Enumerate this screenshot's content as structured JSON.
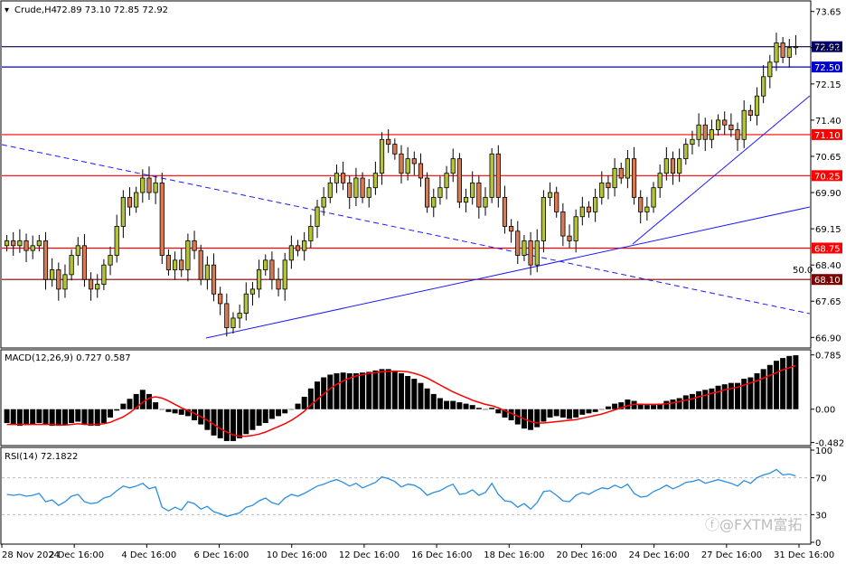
{
  "header": {
    "symbol": "Crude,H4",
    "ohlc": "72.89 73.10 72.85 72.92"
  },
  "watermark": "ⓕ@FXTM富拓",
  "colors": {
    "up_candle": "#b5c437",
    "down_candle": "#d97a52",
    "level": "#ff0000",
    "trend": "#1a1aff",
    "macd_signal": "#ff0000",
    "rsi": "#2b8de0"
  },
  "chart_data": [
    {
      "type": "candlestick",
      "title": "Crude,H4",
      "ylim": [
        66.7,
        73.85
      ],
      "y_ticks": [
        "73.65",
        "72.90",
        "72.15",
        "71.40",
        "70.65",
        "69.90",
        "69.15",
        "68.40",
        "67.65",
        "66.90"
      ],
      "x_ticks": [
        "28 Nov 2024",
        "2 Dec 16:00",
        "4 Dec 16:00",
        "6 Dec 16:00",
        "10 Dec 16:00",
        "12 Dec 16:00",
        "16 Dec 16:00",
        "18 Dec 16:00",
        "20 Dec 16:00",
        "24 Dec 16:00",
        "27 Dec 16:00",
        "31 Dec 16:00"
      ],
      "horizontal_levels": [
        {
          "label": "72.92",
          "value": 72.92,
          "color": "#000066"
        },
        {
          "label": "72.50",
          "value": 72.5,
          "color": "#0000cc"
        },
        {
          "label": "71.10",
          "value": 71.1,
          "color": "#ff0000"
        },
        {
          "label": "70.25",
          "value": 70.25,
          "color": "#ff0000"
        },
        {
          "label": "68.75",
          "value": 68.75,
          "color": "#ff0000"
        },
        {
          "label": "68.10",
          "value": 68.1,
          "color": "#800000"
        }
      ],
      "fib_label": "50.0",
      "close": [
        68.9,
        68.8,
        68.9,
        68.7,
        68.8,
        68.9,
        68.1,
        68.3,
        67.9,
        68.2,
        68.6,
        68.8,
        68.1,
        67.9,
        68.0,
        68.4,
        68.6,
        69.2,
        69.8,
        69.6,
        69.9,
        70.2,
        69.9,
        70.1,
        68.6,
        68.3,
        68.5,
        68.3,
        68.9,
        68.7,
        68.1,
        68.4,
        67.8,
        67.6,
        67.1,
        67.3,
        67.4,
        67.8,
        67.9,
        68.3,
        68.5,
        68.1,
        67.9,
        68.5,
        68.8,
        68.7,
        68.9,
        69.2,
        69.6,
        69.8,
        70.1,
        70.3,
        70.1,
        69.8,
        70.2,
        69.8,
        70.0,
        70.3,
        71.0,
        70.9,
        70.7,
        70.3,
        70.6,
        70.5,
        70.2,
        69.6,
        69.8,
        70.0,
        70.3,
        70.6,
        69.7,
        69.8,
        70.1,
        69.6,
        69.8,
        70.7,
        69.8,
        69.2,
        69.1,
        68.6,
        68.9,
        68.4,
        68.9,
        69.8,
        69.9,
        69.5,
        69.0,
        68.9,
        69.4,
        69.6,
        69.5,
        69.8,
        70.1,
        70.0,
        70.4,
        70.2,
        70.6,
        69.8,
        69.5,
        69.6,
        70.0,
        70.3,
        70.6,
        70.3,
        70.6,
        70.9,
        71.0,
        71.3,
        71.0,
        71.2,
        71.4,
        71.3,
        71.2,
        71.0,
        71.6,
        71.5,
        71.9,
        72.3,
        72.6,
        73.0,
        72.7,
        72.9,
        72.92
      ],
      "ohlc_note": "close series is sufficient to reproduce candle bodies; open equals previous close"
    },
    {
      "type": "bar",
      "title": "MACD(12,26,9) 0.727 0.587",
      "ylim": [
        -0.5,
        0.82
      ],
      "y_ticks": [
        "0.785",
        "0.00",
        "-0.482"
      ],
      "series": [
        {
          "name": "MACD(12,26,9)",
          "values": [
            -0.2,
            -0.22,
            -0.24,
            -0.23,
            -0.22,
            -0.2,
            -0.22,
            -0.24,
            -0.24,
            -0.22,
            -0.2,
            -0.18,
            -0.22,
            -0.24,
            -0.24,
            -0.2,
            -0.12,
            -0.02,
            0.08,
            0.15,
            0.22,
            0.28,
            0.22,
            0.1,
            0.0,
            -0.04,
            -0.06,
            -0.08,
            -0.1,
            -0.16,
            -0.22,
            -0.3,
            -0.38,
            -0.42,
            -0.46,
            -0.46,
            -0.42,
            -0.36,
            -0.3,
            -0.24,
            -0.2,
            -0.14,
            -0.1,
            -0.06,
            0.0,
            0.08,
            0.18,
            0.3,
            0.4,
            0.46,
            0.5,
            0.52,
            0.53,
            0.52,
            0.52,
            0.53,
            0.54,
            0.56,
            0.58,
            0.58,
            0.56,
            0.52,
            0.48,
            0.44,
            0.38,
            0.3,
            0.22,
            0.16,
            0.12,
            0.12,
            0.1,
            0.08,
            0.06,
            0.02,
            0.0,
            0.02,
            -0.06,
            -0.12,
            -0.16,
            -0.22,
            -0.28,
            -0.3,
            -0.26,
            -0.18,
            -0.12,
            -0.1,
            -0.12,
            -0.14,
            -0.12,
            -0.08,
            -0.06,
            -0.04,
            0.0,
            0.04,
            0.08,
            0.1,
            0.14,
            0.12,
            0.08,
            0.06,
            0.06,
            0.08,
            0.12,
            0.14,
            0.16,
            0.2,
            0.22,
            0.26,
            0.28,
            0.3,
            0.34,
            0.36,
            0.38,
            0.38,
            0.44,
            0.46,
            0.52,
            0.58,
            0.64,
            0.7,
            0.74,
            0.77,
            0.78
          ]
        },
        {
          "name": "signal",
          "values": [
            -0.22,
            -0.22,
            -0.22,
            -0.22,
            -0.22,
            -0.22,
            -0.22,
            -0.22,
            -0.23,
            -0.23,
            -0.22,
            -0.21,
            -0.22,
            -0.22,
            -0.22,
            -0.21,
            -0.19,
            -0.15,
            -0.11,
            -0.05,
            0.02,
            0.1,
            0.16,
            0.18,
            0.16,
            0.12,
            0.07,
            0.02,
            -0.02,
            -0.06,
            -0.11,
            -0.16,
            -0.22,
            -0.28,
            -0.33,
            -0.37,
            -0.39,
            -0.39,
            -0.38,
            -0.36,
            -0.33,
            -0.29,
            -0.25,
            -0.21,
            -0.16,
            -0.1,
            -0.03,
            0.06,
            0.14,
            0.22,
            0.3,
            0.36,
            0.41,
            0.45,
            0.48,
            0.5,
            0.52,
            0.53,
            0.54,
            0.55,
            0.55,
            0.55,
            0.54,
            0.52,
            0.49,
            0.45,
            0.4,
            0.35,
            0.3,
            0.25,
            0.21,
            0.17,
            0.13,
            0.1,
            0.07,
            0.05,
            0.02,
            -0.02,
            -0.06,
            -0.1,
            -0.14,
            -0.18,
            -0.2,
            -0.2,
            -0.19,
            -0.18,
            -0.17,
            -0.16,
            -0.15,
            -0.13,
            -0.11,
            -0.09,
            -0.07,
            -0.04,
            -0.01,
            0.02,
            0.05,
            0.07,
            0.07,
            0.07,
            0.07,
            0.07,
            0.08,
            0.09,
            0.11,
            0.13,
            0.15,
            0.18,
            0.2,
            0.23,
            0.25,
            0.28,
            0.3,
            0.32,
            0.35,
            0.38,
            0.41,
            0.45,
            0.49,
            0.53,
            0.57,
            0.6,
            0.63
          ]
        }
      ]
    },
    {
      "type": "line",
      "title": "RSI(14) 72.1822",
      "ylim": [
        0,
        100
      ],
      "y_ticks": [
        "100",
        "70",
        "30",
        "0"
      ],
      "series": [
        {
          "name": "RSI(14)",
          "values": [
            52,
            51,
            52,
            50,
            51,
            53,
            44,
            46,
            40,
            44,
            50,
            52,
            44,
            42,
            43,
            48,
            50,
            56,
            61,
            59,
            61,
            64,
            58,
            60,
            38,
            34,
            38,
            35,
            44,
            42,
            36,
            39,
            33,
            31,
            28,
            30,
            32,
            38,
            40,
            45,
            48,
            43,
            41,
            48,
            52,
            50,
            53,
            57,
            61,
            63,
            66,
            68,
            65,
            61,
            64,
            59,
            62,
            65,
            71,
            69,
            66,
            60,
            63,
            62,
            58,
            51,
            54,
            56,
            60,
            63,
            52,
            53,
            57,
            51,
            54,
            64,
            52,
            45,
            44,
            38,
            42,
            36,
            43,
            55,
            56,
            51,
            45,
            44,
            51,
            54,
            52,
            56,
            59,
            58,
            62,
            59,
            63,
            53,
            49,
            50,
            55,
            58,
            62,
            58,
            61,
            65,
            66,
            68,
            64,
            66,
            68,
            66,
            64,
            61,
            67,
            64,
            70,
            73,
            75,
            79,
            73,
            74,
            72
          ]
        }
      ],
      "levels": [
        70,
        30
      ]
    }
  ]
}
